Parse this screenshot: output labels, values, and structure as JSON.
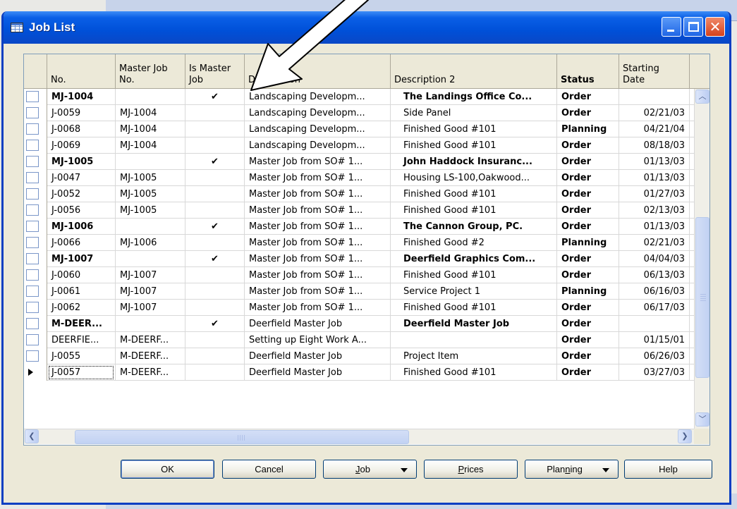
{
  "window": {
    "title": "Job List",
    "close_glyph": "✕"
  },
  "table": {
    "columns": [
      {
        "label": "No."
      },
      {
        "label": "Master Job\nNo."
      },
      {
        "label": "Is Master\nJob"
      },
      {
        "label": "Description"
      },
      {
        "label": "Description 2"
      },
      {
        "label": "Status"
      },
      {
        "label": "Starting\nDate"
      }
    ],
    "check_glyph": "✔",
    "rows": [
      {
        "no": "MJ-1004",
        "master": "",
        "is_master": true,
        "desc": "Landscaping Developm...",
        "desc2": "The Landings Office Co...",
        "status": "Order",
        "date": ""
      },
      {
        "no": "J-0059",
        "master": "MJ-1004",
        "is_master": false,
        "desc": "Landscaping Developm...",
        "desc2": "Side Panel",
        "status": "Order",
        "date": "02/21/03"
      },
      {
        "no": "J-0068",
        "master": "MJ-1004",
        "is_master": false,
        "desc": "Landscaping Developm...",
        "desc2": "Finished Good #101",
        "status": "Planning",
        "date": "04/21/04"
      },
      {
        "no": "J-0069",
        "master": "MJ-1004",
        "is_master": false,
        "desc": "Landscaping Developm...",
        "desc2": "Finished Good #101",
        "status": "Order",
        "date": "08/18/03"
      },
      {
        "no": "MJ-1005",
        "master": "",
        "is_master": true,
        "desc": "Master Job from SO# 1...",
        "desc2": "John Haddock Insuranc...",
        "status": "Order",
        "date": "01/13/03"
      },
      {
        "no": "J-0047",
        "master": "MJ-1005",
        "is_master": false,
        "desc": "Master Job from SO# 1...",
        "desc2": "Housing LS-100,Oakwood...",
        "status": "Order",
        "date": "01/13/03"
      },
      {
        "no": "J-0052",
        "master": "MJ-1005",
        "is_master": false,
        "desc": "Master Job from SO# 1...",
        "desc2": "Finished Good #101",
        "status": "Order",
        "date": "01/27/03"
      },
      {
        "no": "J-0056",
        "master": "MJ-1005",
        "is_master": false,
        "desc": "Master Job from SO# 1...",
        "desc2": "Finished Good #101",
        "status": "Order",
        "date": "02/13/03"
      },
      {
        "no": "MJ-1006",
        "master": "",
        "is_master": true,
        "desc": "Master Job from SO# 1...",
        "desc2": "The Cannon Group, PC.",
        "status": "Order",
        "date": "01/13/03"
      },
      {
        "no": "J-0066",
        "master": "MJ-1006",
        "is_master": false,
        "desc": "Master Job from SO# 1...",
        "desc2": "Finished Good #2",
        "status": "Planning",
        "date": "02/21/03"
      },
      {
        "no": "MJ-1007",
        "master": "",
        "is_master": true,
        "desc": "Master Job from SO# 1...",
        "desc2": "Deerfield Graphics Com...",
        "status": "Order",
        "date": "04/04/03"
      },
      {
        "no": "J-0060",
        "master": "MJ-1007",
        "is_master": false,
        "desc": "Master Job from SO# 1...",
        "desc2": "Finished Good #101",
        "status": "Order",
        "date": "06/13/03"
      },
      {
        "no": "J-0061",
        "master": "MJ-1007",
        "is_master": false,
        "desc": "Master Job from SO# 1...",
        "desc2": "Service Project 1",
        "status": "Planning",
        "date": "06/16/03"
      },
      {
        "no": "J-0062",
        "master": "MJ-1007",
        "is_master": false,
        "desc": "Master Job from SO# 1...",
        "desc2": "Finished Good #101",
        "status": "Order",
        "date": "06/17/03"
      },
      {
        "no": "M-DEER...",
        "master": "",
        "is_master": true,
        "desc": "Deerfield Master Job",
        "desc2": "Deerfield Master Job",
        "status": "Order",
        "date": ""
      },
      {
        "no": "DEERFIE...",
        "master": "M-DEERF...",
        "is_master": false,
        "desc": "Setting up Eight Work A...",
        "desc2": "",
        "status": "Order",
        "date": "01/15/01"
      },
      {
        "no": "J-0055",
        "master": "M-DEERF...",
        "is_master": false,
        "desc": "Deerfield Master Job",
        "desc2": "Project Item",
        "status": "Order",
        "date": "06/26/03"
      },
      {
        "no": "J-0057",
        "master": "M-DEERF...",
        "is_master": false,
        "desc": "Deerfield Master Job",
        "desc2": "Finished Good #101",
        "status": "Order",
        "date": "03/27/03",
        "current": true
      }
    ]
  },
  "scroll": {
    "up_glyph": "︿",
    "down_glyph": "﹀",
    "left_glyph": "❮",
    "right_glyph": "❯"
  },
  "buttons": {
    "ok": "OK",
    "cancel": "Cancel",
    "job": {
      "hotkey": "J",
      "rest": "ob"
    },
    "prices": {
      "hotkey": "P",
      "rest": "rices"
    },
    "planning": {
      "pre": "Plan",
      "hotkey": "n",
      "rest": "ing"
    },
    "help": "Help"
  }
}
